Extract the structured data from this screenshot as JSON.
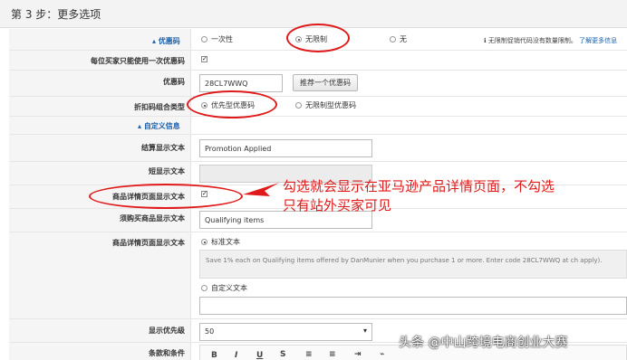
{
  "header": {
    "title": "第 3 步：更多选项"
  },
  "sections": {
    "coupon": "优惠码",
    "custom_info": "自定义信息"
  },
  "coupon": {
    "options": [
      "一次性",
      "无限制",
      "无"
    ],
    "selected": "无限制",
    "info_text": "无限制促销代码没有数量限制。",
    "info_link": "了解更多信息"
  },
  "labels": {
    "once_per_customer": "每位买家只能使用一次优惠码",
    "coupon_code": "优惠码",
    "combo_type": "折扣码组合类型",
    "checkout_text": "结算显示文本",
    "short_text": "短显示文本",
    "detail_page_text": "商品详情页面显示文本",
    "purchase_text": "须购买商品显示文本",
    "detail_page_text2": "商品详情页面显示文本",
    "priority": "显示优先级",
    "terms": "条款和条件"
  },
  "once_per_customer_checked": true,
  "coupon_code_value": "28CL7WWQ",
  "suggest_button": "推荐一个优惠码",
  "combo": {
    "options": [
      "优先型优惠码",
      "无限制型优惠码"
    ],
    "selected": "优先型优惠码"
  },
  "checkout_text_value": "Promotion Applied",
  "detail_page_checked": true,
  "purchase_text_value": "Qualifying items",
  "detail_text": {
    "standard_label": "标准文本",
    "standard_selected": true,
    "standard_desc": "Save 1% each on Qualifying items offered by DanMunier when you purchase 1 or more. Enter code 28CL7WWQ at ch apply).",
    "custom_label": "自定义文本"
  },
  "priority_value": "50",
  "annotation": {
    "line1": "勾选就会显示在亚马逊产品详情页面，不勾选",
    "line2": "只有站外买家可见"
  },
  "watermark": "头条 @中山跨境电商创业大赛",
  "colors": {
    "accent": "#1a5ea8",
    "annotation": "#e01a1a"
  },
  "icons": {
    "info": "info-icon",
    "dropdown": "chevron-down-icon"
  }
}
